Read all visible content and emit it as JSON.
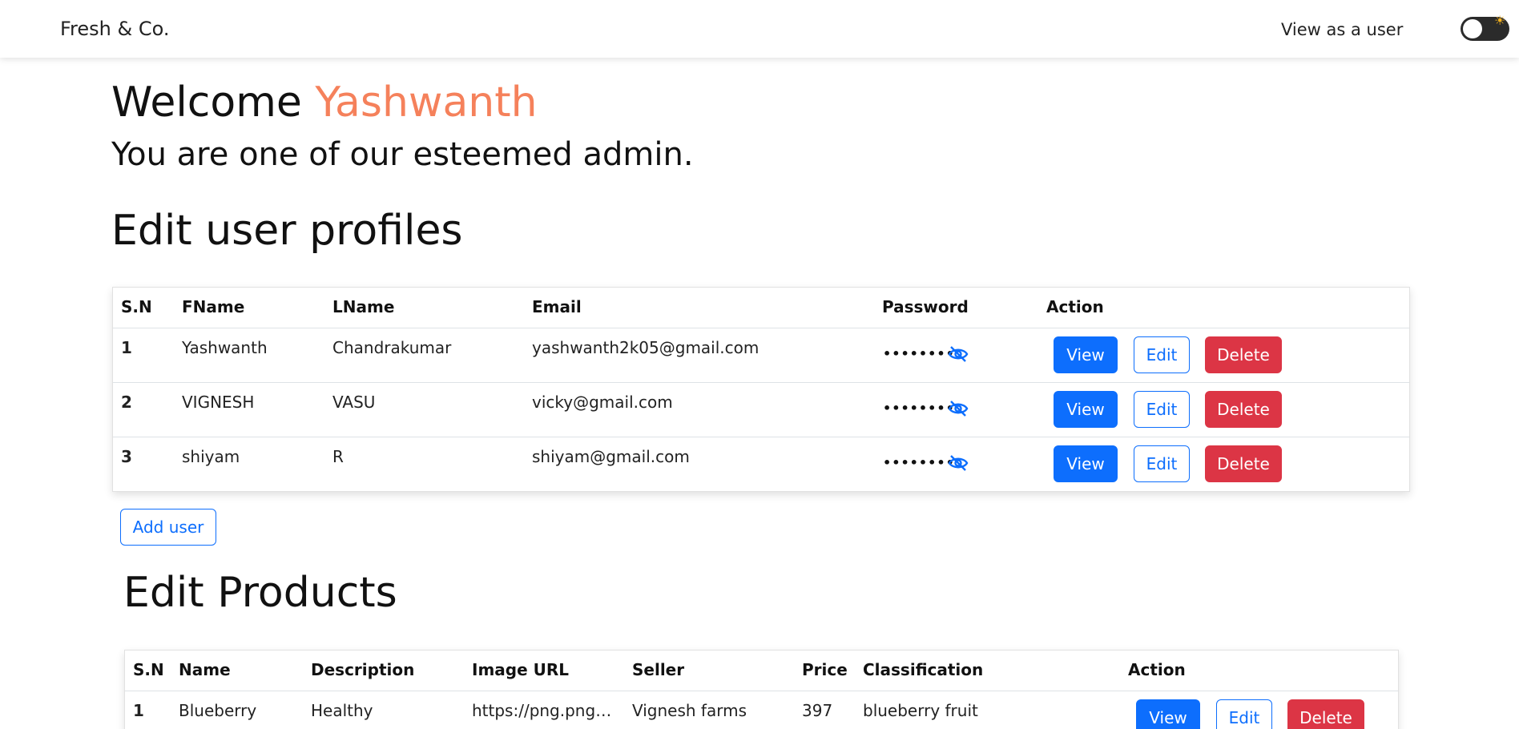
{
  "navbar": {
    "brand": "Fresh & Co.",
    "view_as_user": "View as a user",
    "toggle_icon": "sun-icon"
  },
  "welcome": {
    "prefix": "Welcome",
    "name": "Yashwanth",
    "subtitle": "You are one of our esteemed admin."
  },
  "users_section": {
    "title": "Edit user profiles",
    "headers": [
      "S.N",
      "FName",
      "LName",
      "Email",
      "Password",
      "Action"
    ],
    "rows": [
      {
        "sn": "1",
        "fname": "Yashwanth",
        "lname": "Chandrakumar",
        "email": "yashwanth2k05@gmail.com",
        "password": "••••••••"
      },
      {
        "sn": "2",
        "fname": "VIGNESH",
        "lname": "VASU",
        "email": "vicky@gmail.com",
        "password": "••••••••"
      },
      {
        "sn": "3",
        "fname": "shiyam",
        "lname": "R",
        "email": "shiyam@gmail.com",
        "password": "••••••••"
      }
    ],
    "add_user_label": "Add user"
  },
  "actions": {
    "view": "View",
    "edit": "Edit",
    "delete": "Delete"
  },
  "products_section": {
    "title": "Edit Products",
    "headers": [
      "S.N",
      "Name",
      "Description",
      "Image URL",
      "Seller",
      "Price",
      "Classification",
      "Action"
    ],
    "rows": [
      {
        "sn": "1",
        "name": "Blueberry",
        "description": "Healthy",
        "image_url": "https://png.pngtree.com",
        "seller": "Vignesh farms",
        "price": "397",
        "classification": "blueberry fruit"
      }
    ]
  },
  "colors": {
    "accent_name": "#f5815b",
    "primary": "#0d6efd",
    "danger": "#dc3545"
  }
}
